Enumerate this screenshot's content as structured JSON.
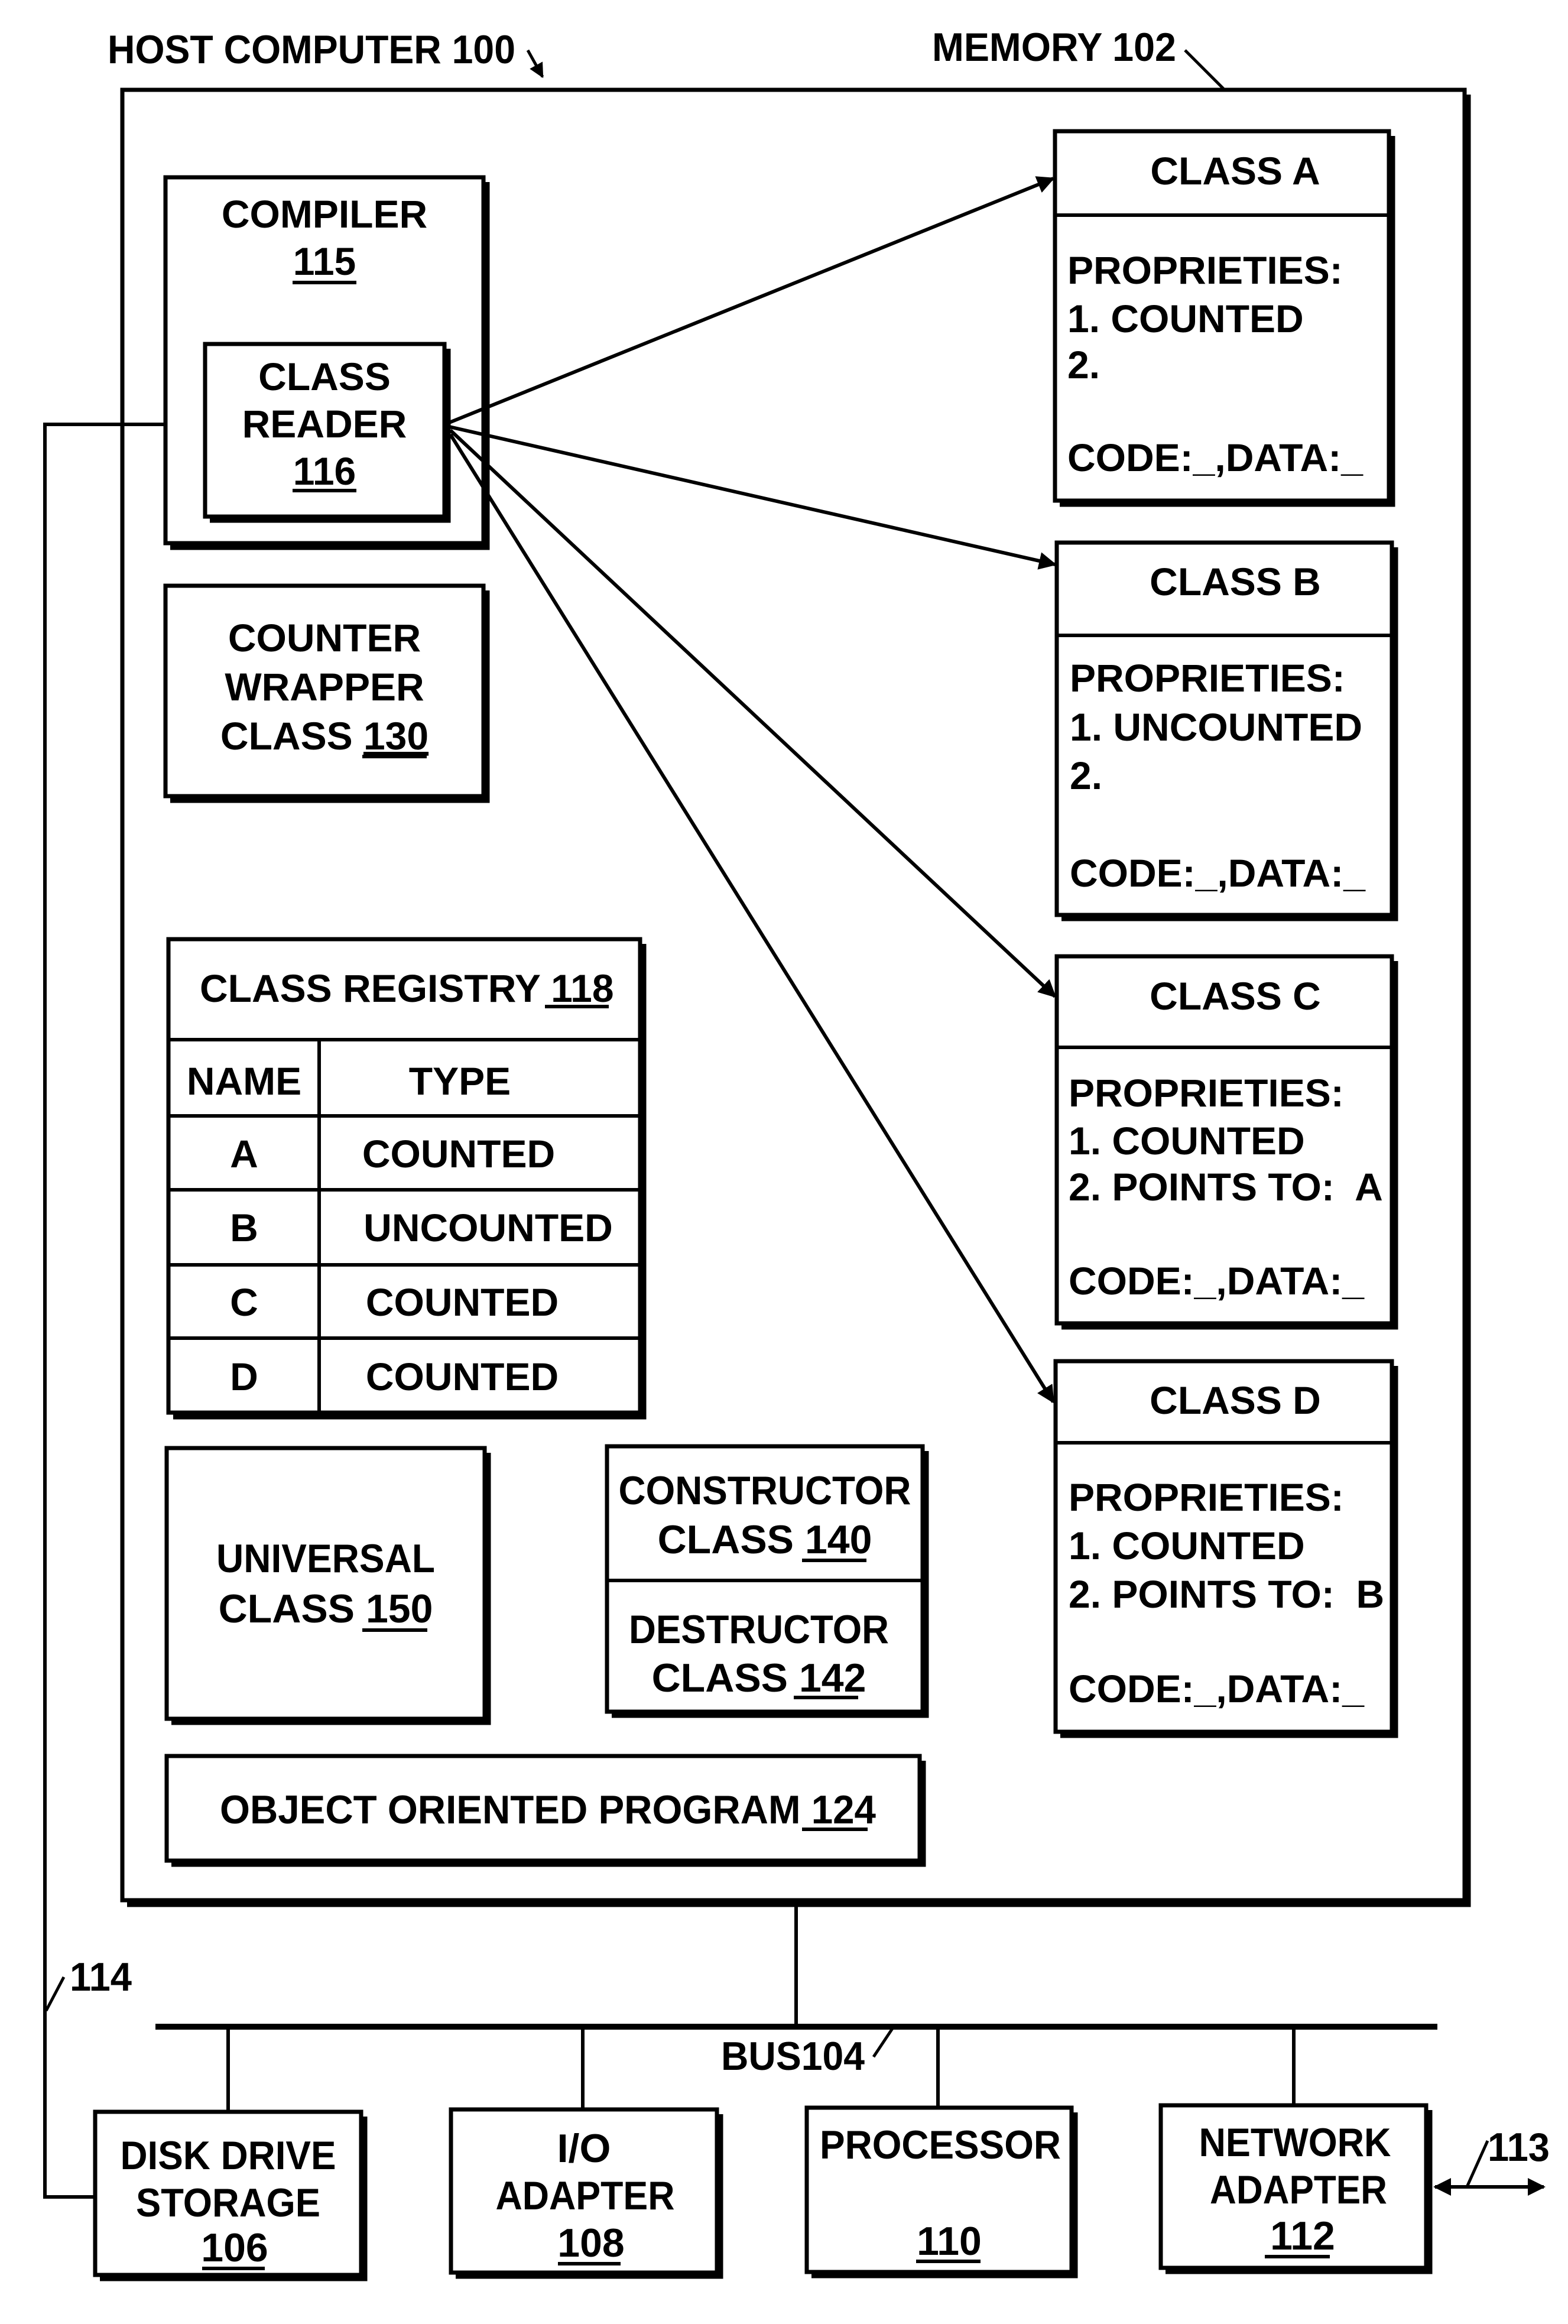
{
  "figure": {
    "host_label": "HOST COMPUTER 100",
    "memory_label": "MEMORY 102",
    "bus_label": "BUS104",
    "wire_label": "114",
    "network_link_label": "113"
  },
  "memory": {
    "compiler": {
      "title": "COMPILER",
      "ref": "115"
    },
    "class_reader": {
      "line1": "CLASS",
      "line2": "READER",
      "ref": "116"
    },
    "counter_wrapper": {
      "line1": "COUNTER",
      "line2": "WRAPPER",
      "line3_prefix": "CLASS ",
      "ref": "130"
    },
    "class_registry": {
      "title_prefix": "CLASS REGISTRY ",
      "ref": "118",
      "headers": [
        "NAME",
        "TYPE"
      ],
      "rows": [
        {
          "name": "A",
          "type": "COUNTED"
        },
        {
          "name": "B",
          "type": "UNCOUNTED"
        },
        {
          "name": "C",
          "type": "COUNTED"
        },
        {
          "name": "D",
          "type": "COUNTED"
        }
      ]
    },
    "universal": {
      "line1": "UNIVERSAL",
      "line2_prefix": "CLASS ",
      "ref": "150"
    },
    "constructor": {
      "line1": "CONSTRUCTOR",
      "line2_prefix": "CLASS ",
      "ref": "140"
    },
    "destructor": {
      "line1": "DESTRUCTOR",
      "line2_prefix": "CLASS ",
      "ref": "142"
    },
    "oop": {
      "prefix": "OBJECT ORIENTED PROGRAM ",
      "ref": "124"
    },
    "classes": [
      {
        "title": "CLASS A",
        "heading": "PROPRIETIES:",
        "prop1": "1. COUNTED",
        "prop2": "2.",
        "code": "CODE:_,DATA:_"
      },
      {
        "title": "CLASS B",
        "heading": "PROPRIETIES:",
        "prop1": "1. UNCOUNTED",
        "prop2": "2.",
        "code": "CODE:_,DATA:_"
      },
      {
        "title": "CLASS C",
        "heading": "PROPRIETIES:",
        "prop1": "1. COUNTED",
        "prop2": "2. POINTS TO:  A",
        "code": "CODE:_,DATA:_"
      },
      {
        "title": "CLASS D",
        "heading": "PROPRIETIES:",
        "prop1": "1. COUNTED",
        "prop2": "2. POINTS TO:  B",
        "code": "CODE:_,DATA:_"
      }
    ]
  },
  "devices": [
    {
      "line1": "DISK DRIVE",
      "line2": "STORAGE",
      "ref": "106"
    },
    {
      "line1": "I/O",
      "line2": "ADAPTER",
      "ref": "108"
    },
    {
      "line1": "PROCESSOR",
      "line2": "",
      "ref": "110"
    },
    {
      "line1": "NETWORK",
      "line2": "ADAPTER",
      "ref": "112"
    }
  ]
}
